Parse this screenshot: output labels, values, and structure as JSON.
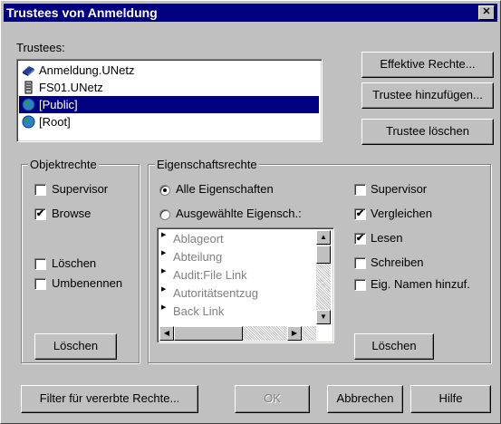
{
  "window": {
    "title": "Trustees von Anmeldung",
    "close_glyph": "✕"
  },
  "trustees": {
    "label": "Trustees:",
    "items": [
      {
        "name": "Anmeldung.UNetz",
        "icon": "container-book-icon",
        "selected": false
      },
      {
        "name": "FS01.UNetz",
        "icon": "server-icon",
        "selected": false
      },
      {
        "name": "[Public]",
        "icon": "globe-icon",
        "selected": true
      },
      {
        "name": "[Root]",
        "icon": "globe-icon",
        "selected": false
      }
    ]
  },
  "right_buttons": {
    "effective": "Effektive Rechte...",
    "add": "Trustee hinzufügen...",
    "delete": "Trustee löschen"
  },
  "object_rights": {
    "label": "Objektrechte",
    "items": [
      {
        "label": "Supervisor",
        "checked": false
      },
      {
        "label": "Browse",
        "checked": true
      },
      {
        "label": "Löschen",
        "checked": false
      },
      {
        "label": "Umbenennen",
        "checked": false
      }
    ],
    "button": "Löschen"
  },
  "property_rights": {
    "label": "Eigenschaftsrechte",
    "radio_all": "Alle Eigenschaften",
    "radio_selected": "Ausgewählte Eigensch.:",
    "selected_radio": "all",
    "properties": [
      "Ablageort",
      "Abteilung",
      "Audit:File Link",
      "Autoritätsentzug",
      "Back Link"
    ],
    "rights": [
      {
        "label": "Supervisor",
        "checked": false
      },
      {
        "label": "Vergleichen",
        "checked": true
      },
      {
        "label": "Lesen",
        "checked": true
      },
      {
        "label": "Schreiben",
        "checked": false
      },
      {
        "label": "Eig. Namen hinzuf.",
        "checked": false
      }
    ],
    "button": "Löschen"
  },
  "footer": {
    "filter": "Filter für vererbte Rechte...",
    "ok": "OK",
    "cancel": "Abbrechen",
    "help": "Hilfe"
  },
  "check_glyph": "✔"
}
